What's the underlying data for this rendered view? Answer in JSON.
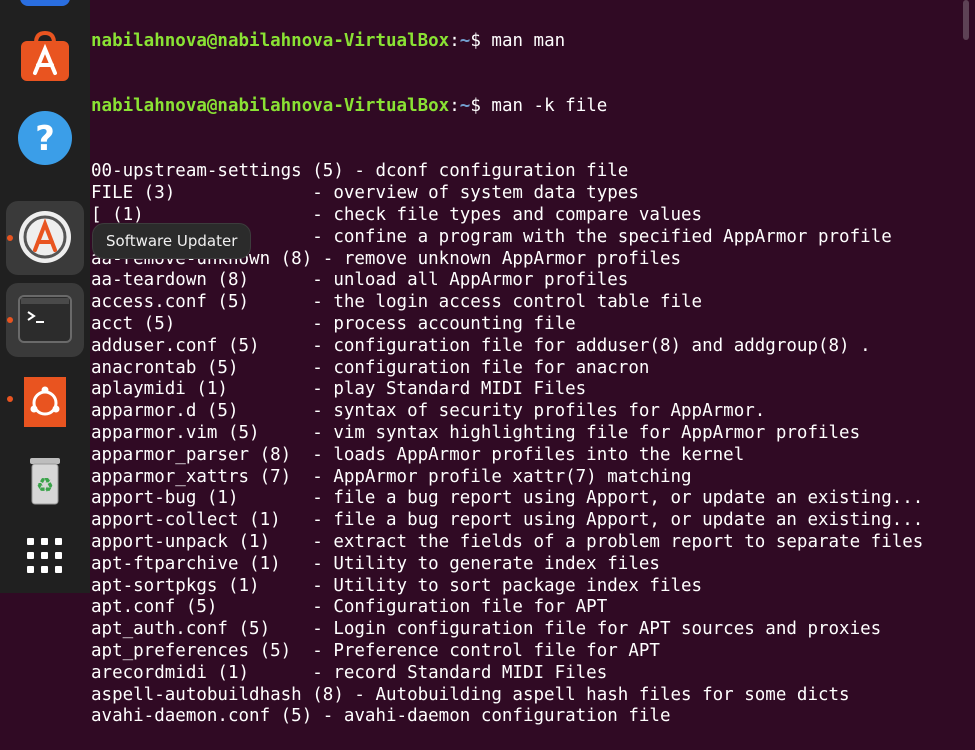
{
  "dock": {
    "tooltip": "Software Updater",
    "apps": [
      {
        "name": "app-center"
      },
      {
        "name": "help"
      },
      {
        "name": "software-updater"
      },
      {
        "name": "terminal"
      },
      {
        "name": "ubuntu-app"
      },
      {
        "name": "trash"
      },
      {
        "name": "show-apps"
      }
    ]
  },
  "terminal": {
    "prev_prompt": {
      "user": "nabilahnova@nabilahnova-VirtualBox",
      "path": "~",
      "command": "man man"
    },
    "prompt": {
      "user": "nabilahnova@nabilahnova-VirtualBox",
      "path": "~",
      "command": "man -k file"
    },
    "lines": [
      "00-upstream-settings (5) - dconf configuration file",
      "FILE (3)             - overview of system data types",
      "[ (1)                - check file types and compare values",
      "aa-exec (1)          - confine a program with the specified AppArmor profile",
      "aa-remove-unknown (8) - remove unknown AppArmor profiles",
      "aa-teardown (8)      - unload all AppArmor profiles",
      "access.conf (5)      - the login access control table file",
      "acct (5)             - process accounting file",
      "adduser.conf (5)     - configuration file for adduser(8) and addgroup(8) .",
      "anacrontab (5)       - configuration file for anacron",
      "aplaymidi (1)        - play Standard MIDI Files",
      "apparmor.d (5)       - syntax of security profiles for AppArmor.",
      "apparmor.vim (5)     - vim syntax highlighting file for AppArmor profiles",
      "apparmor_parser (8)  - loads AppArmor profiles into the kernel",
      "apparmor_xattrs (7)  - AppArmor profile xattr(7) matching",
      "apport-bug (1)       - file a bug report using Apport, or update an existing...",
      "apport-collect (1)   - file a bug report using Apport, or update an existing...",
      "apport-unpack (1)    - extract the fields of a problem report to separate files",
      "apt-ftparchive (1)   - Utility to generate index files",
      "apt-sortpkgs (1)     - Utility to sort package index files",
      "apt.conf (5)         - Configuration file for APT",
      "apt_auth.conf (5)    - Login configuration file for APT sources and proxies",
      "apt_preferences (5)  - Preference control file for APT",
      "arecordmidi (1)      - record Standard MIDI Files",
      "aspell-autobuildhash (8) - Autobuilding aspell hash files for some dicts",
      "avahi-daemon.conf (5) - avahi-daemon configuration file"
    ]
  }
}
